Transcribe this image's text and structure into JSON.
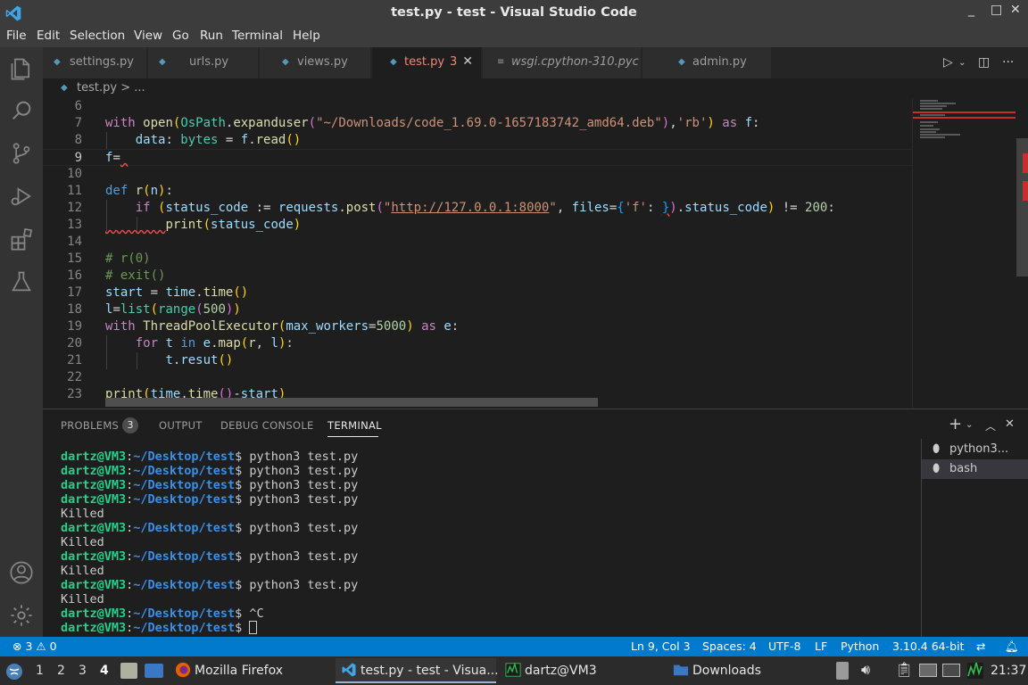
{
  "window": {
    "title": "test.py - test - Visual Studio Code",
    "minimize": "_",
    "maximize": "□",
    "close": "✕"
  },
  "menu": [
    "File",
    "Edit",
    "Selection",
    "View",
    "Go",
    "Run",
    "Terminal",
    "Help"
  ],
  "tabs": [
    {
      "label": "settings.py",
      "icon": "python-icon"
    },
    {
      "label": "urls.py",
      "icon": "python-icon"
    },
    {
      "label": "views.py",
      "icon": "python-icon"
    },
    {
      "label": "test.py",
      "count": "3",
      "icon": "python-icon",
      "active": true
    },
    {
      "label": "wsgi.cpython-310.pyc",
      "icon": "file-icon"
    },
    {
      "label": "admin.py",
      "icon": "python-icon"
    }
  ],
  "breadcrumb": {
    "file": "test.py",
    "rest": "> ..."
  },
  "editor": {
    "line_numbers": [
      "6",
      "7",
      "8",
      "9",
      "10",
      "11",
      "12",
      "13",
      "14",
      "15",
      "16",
      "17",
      "18",
      "19",
      "20",
      "21",
      "22",
      "23"
    ],
    "current_line": "9"
  },
  "panel": {
    "tabs": [
      "PROBLEMS",
      "OUTPUT",
      "DEBUG CONSOLE",
      "TERMINAL"
    ],
    "problems_count": "3",
    "active_tab": "TERMINAL"
  },
  "terminal": {
    "user": "dartz@VM3",
    "path": "~/Desktop/test",
    "lines": [
      {
        "type": "prompt",
        "cmd": " python3 test.py"
      },
      {
        "type": "prompt",
        "cmd": " python3 test.py"
      },
      {
        "type": "prompt",
        "cmd": " python3 test.py"
      },
      {
        "type": "prompt",
        "cmd": " python3 test.py"
      },
      {
        "type": "output",
        "text": "Killed"
      },
      {
        "type": "prompt",
        "cmd": " python3 test.py"
      },
      {
        "type": "output",
        "text": "Killed"
      },
      {
        "type": "prompt",
        "cmd": " python3 test.py"
      },
      {
        "type": "output",
        "text": "Killed"
      },
      {
        "type": "prompt",
        "cmd": " python3 test.py"
      },
      {
        "type": "output",
        "text": "Killed"
      },
      {
        "type": "prompt",
        "cmd": " ^C"
      },
      {
        "type": "prompt",
        "cmd": " ",
        "cursor": true
      }
    ],
    "instances": [
      {
        "label": "python3...",
        "selected": false
      },
      {
        "label": "bash",
        "selected": true
      }
    ]
  },
  "statusbar": {
    "errors": "3",
    "warnings": "0",
    "position": "Ln 9, Col 3",
    "spaces": "Spaces: 4",
    "encoding": "UTF-8",
    "eol": "LF",
    "language": "Python",
    "interpreter": "3.10.4 64-bit"
  },
  "taskbar": {
    "workspaces": [
      "1",
      "2",
      "3",
      "4"
    ],
    "active_workspace": "4",
    "tasks": [
      {
        "label": "Mozilla Firefox",
        "icon": "firefox-icon"
      },
      {
        "label": "test.py - test - Visua...",
        "icon": "vscode-icon",
        "active": true
      },
      {
        "label": "dartz@VM3",
        "icon": "terminal-icon"
      },
      {
        "label": "Downloads",
        "icon": "folder-icon"
      }
    ],
    "clock": "21:37"
  },
  "colors": {
    "accent": "#007acc",
    "title_bg": "#3c3c3c",
    "editor_bg": "#1e1e1e",
    "error": "#f14c4c",
    "terminal_green": "#23d18b",
    "terminal_blue": "#3b8eea"
  }
}
